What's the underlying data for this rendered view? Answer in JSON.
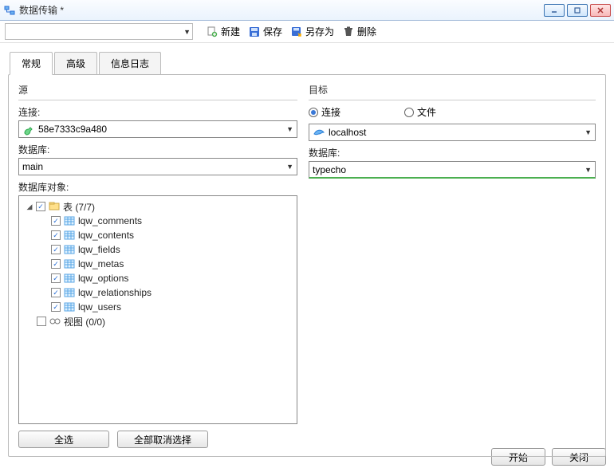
{
  "window": {
    "title": "数据传输 *"
  },
  "toolbar": {
    "new_label": "新建",
    "save_label": "保存",
    "saveas_label": "另存为",
    "delete_label": "删除"
  },
  "tabs": [
    {
      "label": "常规",
      "active": true
    },
    {
      "label": "高级",
      "active": false
    },
    {
      "label": "信息日志",
      "active": false
    }
  ],
  "source": {
    "group_title": "源",
    "connection_label": "连接:",
    "connection_value": "58e7333c9a480",
    "database_label": "数据库:",
    "database_value": "main",
    "objects_label": "数据库对象:",
    "tree": {
      "tables_label": "表 (7/7)",
      "tables": [
        "lqw_comments",
        "lqw_contents",
        "lqw_fields",
        "lqw_metas",
        "lqw_options",
        "lqw_relationships",
        "lqw_users"
      ],
      "views_label": "视图 (0/0)"
    },
    "select_all_label": "全选",
    "deselect_all_label": "全部取消选择"
  },
  "target": {
    "group_title": "目标",
    "radio_connection_label": "连接",
    "radio_file_label": "文件",
    "connection_value": "localhost",
    "database_label": "数据库:",
    "database_value": "typecho"
  },
  "footer": {
    "start_label": "开始",
    "close_label": "关闭"
  }
}
